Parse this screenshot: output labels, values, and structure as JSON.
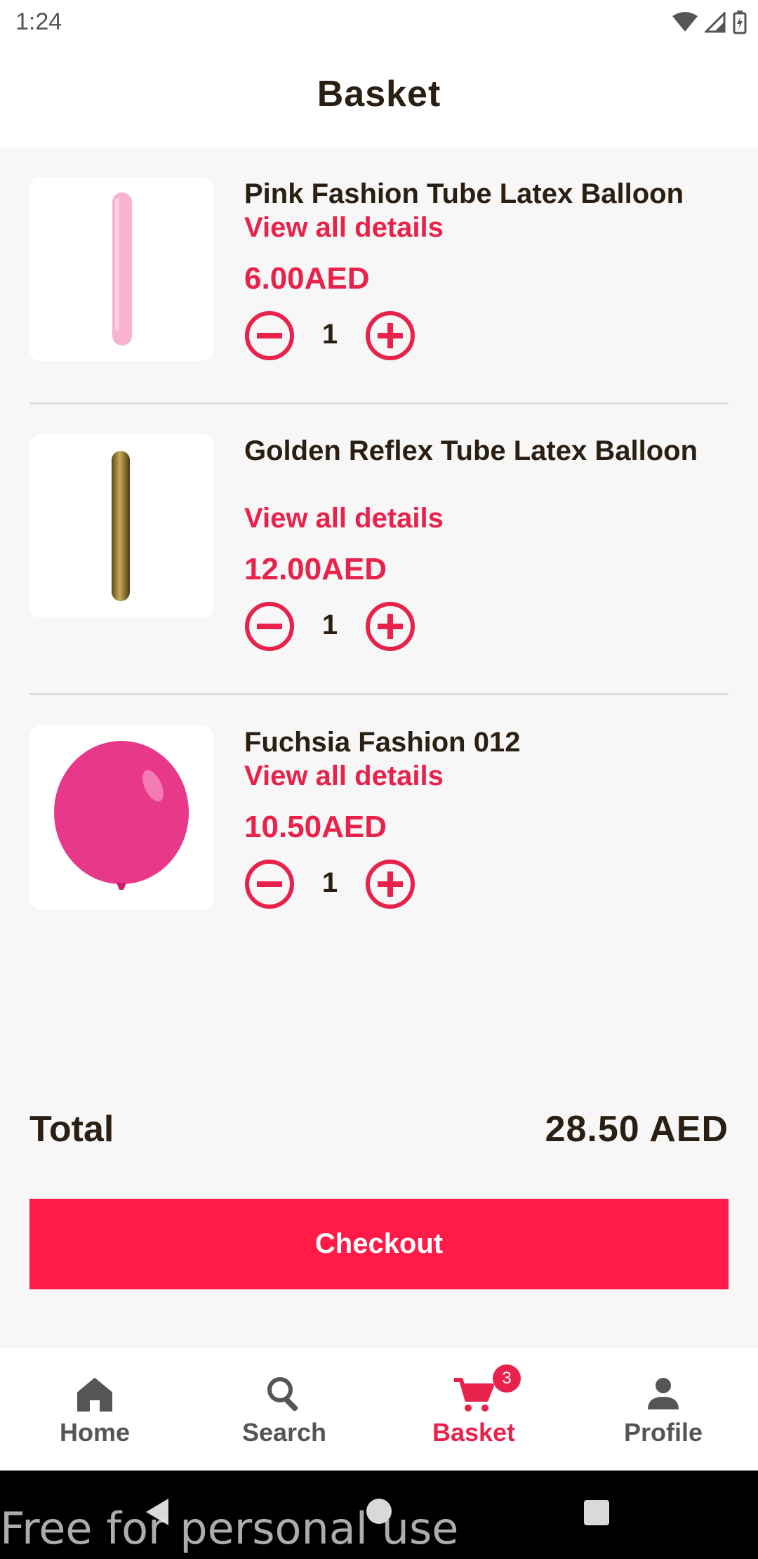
{
  "status_bar": {
    "time": "1:24"
  },
  "header": {
    "title": "Basket"
  },
  "items": [
    {
      "name": "Pink Fashion Tube Latex Balloon",
      "details_label": "View all details",
      "price": "6.00AED",
      "quantity": "1"
    },
    {
      "name": "Golden Reflex Tube Latex Balloon",
      "details_label": "View all details",
      "price": "12.00AED",
      "quantity": "1"
    },
    {
      "name": "Fuchsia Fashion 012",
      "details_label": "View all details",
      "price": "10.50AED",
      "quantity": "1"
    }
  ],
  "summary": {
    "total_label": "Total",
    "total_value": "28.50 AED"
  },
  "checkout_label": "Checkout",
  "bottom_nav": {
    "items": [
      {
        "label": "Home",
        "icon": "home-icon"
      },
      {
        "label": "Search",
        "icon": "search-icon"
      },
      {
        "label": "Basket",
        "icon": "cart-icon",
        "badge": "3",
        "active": true
      },
      {
        "label": "Profile",
        "icon": "person-icon"
      }
    ]
  },
  "watermark": "Free for personal use",
  "colors": {
    "accent": "#e8224b",
    "checkout": "#ff1a47",
    "text": "#2a1f12"
  }
}
